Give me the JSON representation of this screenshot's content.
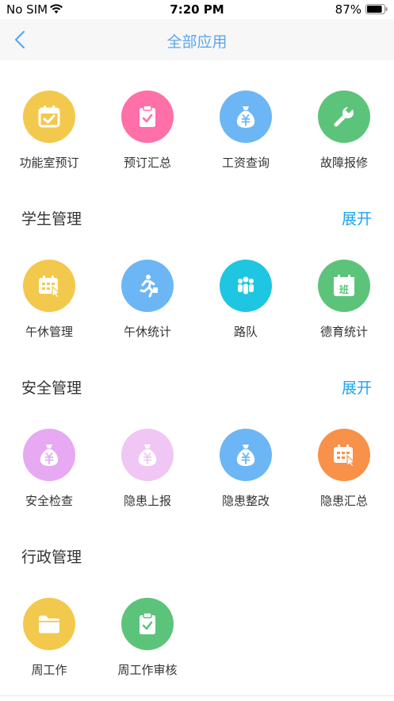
{
  "status_bar": {
    "carrier": "No SIM",
    "time": "7:20 PM",
    "battery": "87%"
  },
  "nav": {
    "title": "全部应用",
    "back_icon": "chevron-left-icon"
  },
  "colors": {
    "yellow": "#f2c94c",
    "pink": "#ff6fa8",
    "blue": "#6cb6f5",
    "green": "#5cc47a",
    "cyan": "#1ec6e2",
    "lilac": "#e6a9f2",
    "light_lilac": "#f0c6f4",
    "orange": "#f8914a",
    "accent": "#1aa4ee"
  },
  "quick_apps": [
    {
      "label": "功能室预订",
      "icon": "calendar-check-icon",
      "color": "#f2c94c"
    },
    {
      "label": "预订汇总",
      "icon": "clipboard-check-icon",
      "color": "#ff6fa8"
    },
    {
      "label": "工资查询",
      "icon": "money-bag-icon",
      "color": "#6cb6f5"
    },
    {
      "label": "故障报修",
      "icon": "wrench-icon",
      "color": "#5cc47a"
    }
  ],
  "sections": [
    {
      "title": "学生管理",
      "action": "展开",
      "apps": [
        {
          "label": "午休管理",
          "icon": "calendar-pointer-icon",
          "color": "#f2c94c"
        },
        {
          "label": "午休统计",
          "icon": "running-person-icon",
          "color": "#6cb6f5"
        },
        {
          "label": "路队",
          "icon": "people-group-icon",
          "color": "#1ec6e2"
        },
        {
          "label": "德育统计",
          "icon": "class-calendar-icon",
          "color": "#5cc47a",
          "glyph": "班"
        }
      ]
    },
    {
      "title": "安全管理",
      "action": "展开",
      "apps": [
        {
          "label": "安全检查",
          "icon": "money-bag-icon",
          "color": "#e6a9f2"
        },
        {
          "label": "隐患上报",
          "icon": "money-bag-icon",
          "color": "#f0c6f4"
        },
        {
          "label": "隐患整改",
          "icon": "money-bag-icon",
          "color": "#6cb6f5"
        },
        {
          "label": "隐患汇总",
          "icon": "calendar-pointer-icon",
          "color": "#f8914a"
        }
      ]
    },
    {
      "title": "行政管理",
      "apps": [
        {
          "label": "周工作",
          "icon": "folder-icon",
          "color": "#f2c94c"
        },
        {
          "label": "周工作审核",
          "icon": "clipboard-check-icon",
          "color": "#5cc47a"
        }
      ]
    }
  ]
}
